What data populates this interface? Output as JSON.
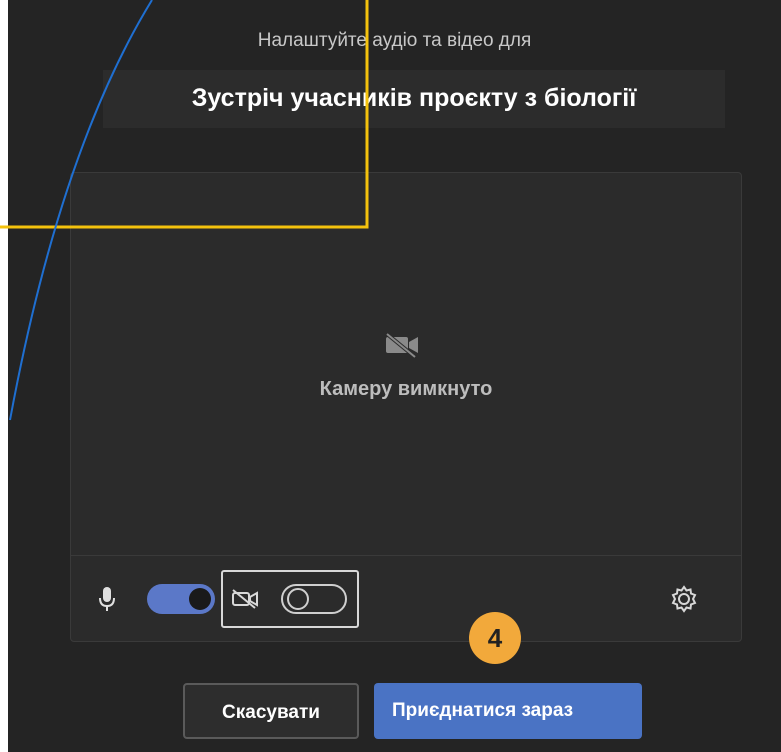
{
  "dialog": {
    "subtitle": "Налаштуйте аудіо та відео для",
    "meeting_title": "Зустріч учасників проєкту з біології"
  },
  "preview": {
    "camera_status": "Камеру вимкнуто"
  },
  "controls": {
    "mic_enabled": true,
    "camera_enabled": false
  },
  "badge": {
    "number": "4"
  },
  "buttons": {
    "cancel_label": "Скасувати",
    "join_label": "Приєднатися зараз"
  },
  "colors": {
    "accent": "#5b78c8",
    "badge": "#f2a93b",
    "highlight_frame": "#f4c20d",
    "callout_line": "#1f6fd1"
  }
}
